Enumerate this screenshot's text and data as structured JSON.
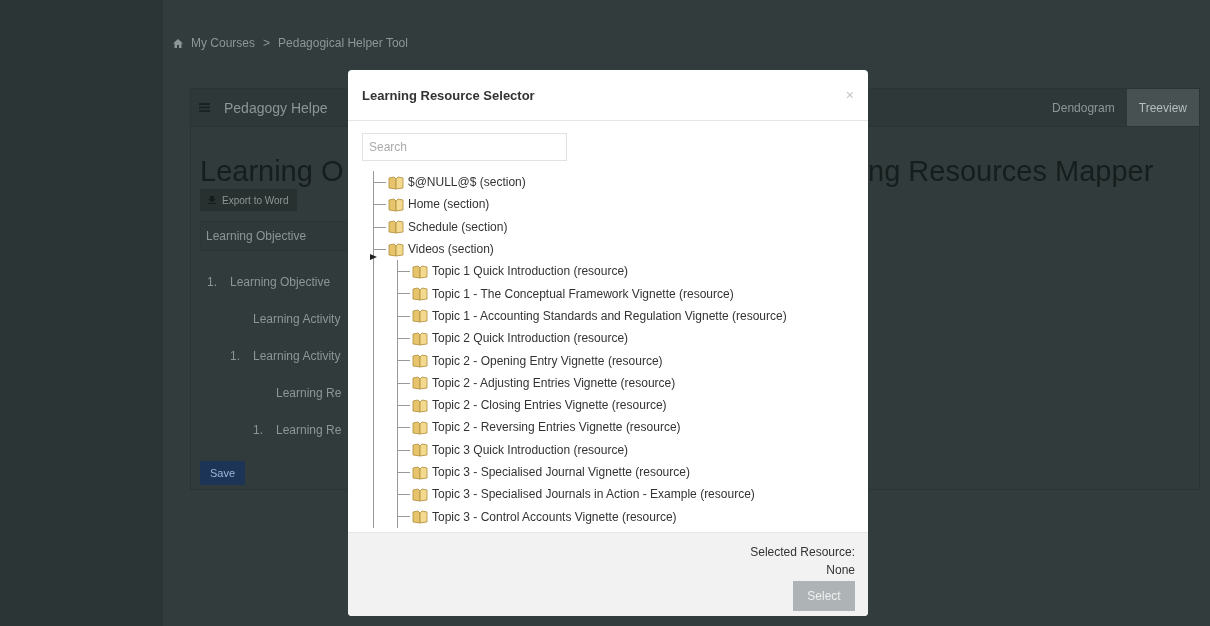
{
  "breadcrumb": {
    "items": [
      "My Courses",
      "Pedagogical Helper Tool"
    ],
    "separator": ">"
  },
  "panel": {
    "title": "Pedagogy Helpe",
    "tabs": [
      {
        "label": "Dendogram",
        "selected": false
      },
      {
        "label": "Treeview",
        "selected": true
      }
    ]
  },
  "heading": {
    "left": "Learning O",
    "right": "ng Resources Mapper"
  },
  "export_button": "Export to Word",
  "objective_field": {
    "value": "Learning Objective"
  },
  "outline": [
    {
      "number": "1.",
      "label": "Learning Objective",
      "children": [
        {
          "label": "Learning Activity"
        },
        {
          "number": "1.",
          "label": "Learning Activity",
          "children": [
            {
              "label": "Learning Re"
            },
            {
              "number": "1.",
              "label": "Learning Re"
            }
          ]
        }
      ]
    }
  ],
  "save_button": "Save",
  "modal": {
    "title": "Learning Resource Selector",
    "close": "×",
    "search": {
      "placeholder": "Search"
    },
    "tree": [
      {
        "label": "$@NULL@$ (section)",
        "expanded": false
      },
      {
        "label": "Home (section)",
        "expanded": false
      },
      {
        "label": "Schedule (section)",
        "expanded": false
      },
      {
        "label": "Videos (section)",
        "expanded": true,
        "children": [
          {
            "label": "Topic 1 Quick Introduction (resource)"
          },
          {
            "label": "Topic 1 - The Conceptual Framework Vignette (resource)"
          },
          {
            "label": "Topic 1 - Accounting Standards and Regulation Vignette (resource)"
          },
          {
            "label": "Topic 2 Quick Introduction (resource)"
          },
          {
            "label": "Topic 2 - Opening Entry Vignette (resource)"
          },
          {
            "label": "Topic 2 - Adjusting Entries Vignette (resource)"
          },
          {
            "label": "Topic 2 - Closing Entries Vignette (resource)"
          },
          {
            "label": "Topic 2 - Reversing Entries Vignette (resource)"
          },
          {
            "label": "Topic 3 Quick Introduction (resource)"
          },
          {
            "label": "Topic 3 - Specialised Journal Vignette (resource)"
          },
          {
            "label": "Topic 3 - Specialised Journals in Action - Example (resource)"
          },
          {
            "label": "Topic 3 - Control Accounts Vignette (resource)"
          }
        ]
      }
    ],
    "selected_label": "Selected Resource:",
    "selected_value": "None",
    "select_button": {
      "label": "Select",
      "disabled": true
    }
  }
}
